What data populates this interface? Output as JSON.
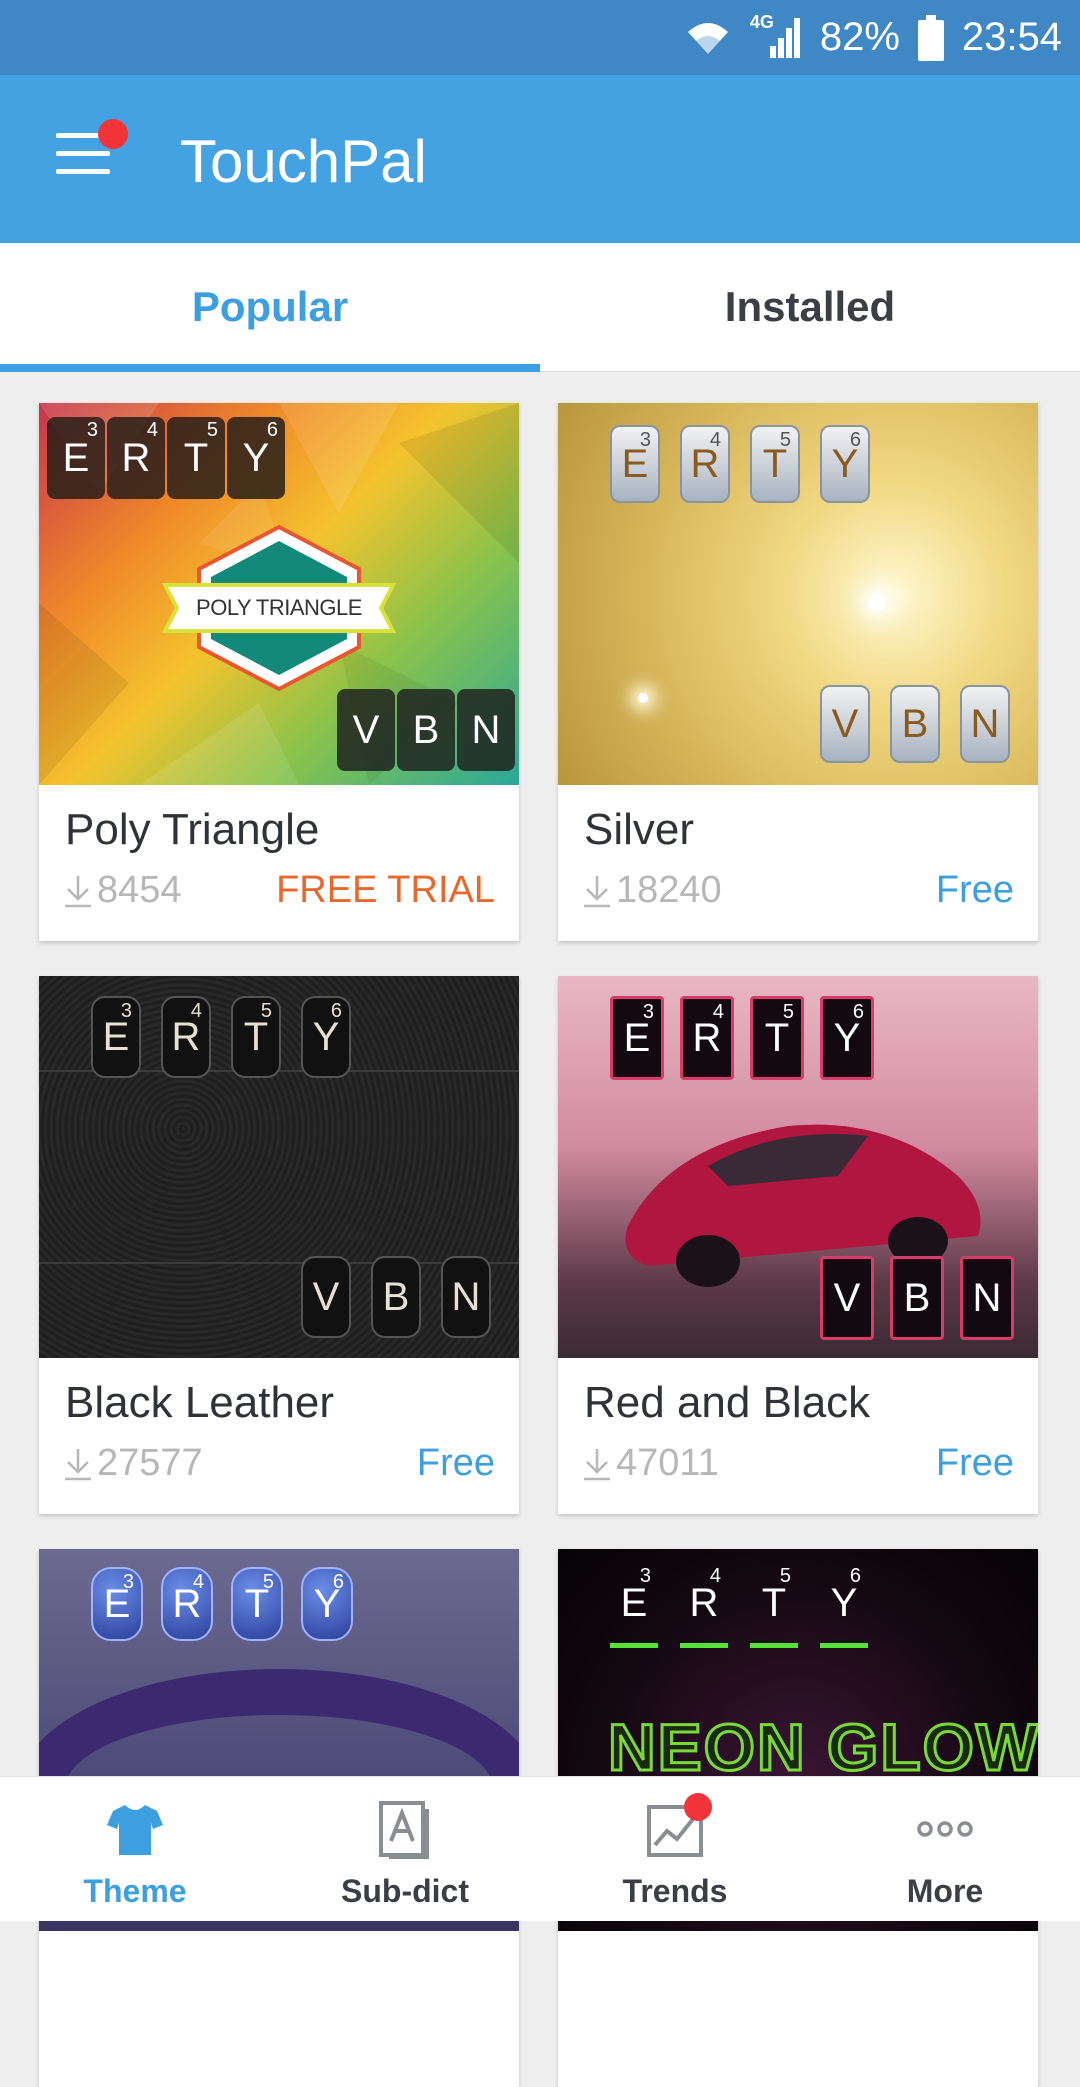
{
  "status": {
    "network": "4G",
    "battery": "82%",
    "time": "23:54"
  },
  "app": {
    "title": "TouchPal"
  },
  "tabs": [
    {
      "label": "Popular",
      "active": true
    },
    {
      "label": "Installed",
      "active": false
    }
  ],
  "themes": [
    {
      "name": "Poly Triangle",
      "downloads": "8454",
      "price": "FREE TRIAL",
      "price_color": "#e8682c",
      "keys_top": [
        "E",
        "R",
        "T",
        "Y"
      ],
      "keys_top_sup": [
        "3",
        "4",
        "5",
        "6"
      ],
      "keys_bottom": [
        "V",
        "B",
        "N"
      ],
      "banner": "POLY TRIANGLE"
    },
    {
      "name": "Silver",
      "downloads": "18240",
      "price": "Free",
      "price_color": "#3d9ee0",
      "keys_top": [
        "E",
        "R",
        "T",
        "Y"
      ],
      "keys_top_sup": [
        "3",
        "4",
        "5",
        "6"
      ],
      "keys_bottom": [
        "V",
        "B",
        "N"
      ]
    },
    {
      "name": "Black Leather",
      "downloads": "27577",
      "price": "Free",
      "price_color": "#3d9ee0",
      "keys_top": [
        "E",
        "R",
        "T",
        "Y"
      ],
      "keys_top_sup": [
        "3",
        "4",
        "5",
        "6"
      ],
      "keys_bottom": [
        "V",
        "B",
        "N"
      ]
    },
    {
      "name": "Red and Black",
      "downloads": "47011",
      "price": "Free",
      "price_color": "#3d9ee0",
      "keys_top": [
        "E",
        "R",
        "T",
        "Y"
      ],
      "keys_top_sup": [
        "3",
        "4",
        "5",
        "6"
      ],
      "keys_bottom": [
        "V",
        "B",
        "N"
      ]
    },
    {
      "name": "",
      "keys_top": [
        "E",
        "R",
        "T",
        "Y"
      ],
      "keys_top_sup": [
        "3",
        "4",
        "5",
        "6"
      ]
    },
    {
      "name": "",
      "keys_top": [
        "E",
        "R",
        "T",
        "Y"
      ],
      "keys_top_sup": [
        "3",
        "4",
        "5",
        "6"
      ],
      "banner": "NEON GLOW"
    }
  ],
  "bottom_nav": [
    {
      "label": "Theme",
      "icon": "tshirt-icon",
      "active": true
    },
    {
      "label": "Sub-dict",
      "icon": "dictionary-icon",
      "active": false
    },
    {
      "label": "Trends",
      "icon": "trends-icon",
      "active": false,
      "badge": true
    },
    {
      "label": "More",
      "icon": "more-icon",
      "active": false
    }
  ],
  "colors": {
    "accent": "#3d9ee0",
    "appbar": "#45a2e2",
    "statusbar": "#3f88c5",
    "badge": "#f1333a",
    "trial": "#e8682c"
  }
}
